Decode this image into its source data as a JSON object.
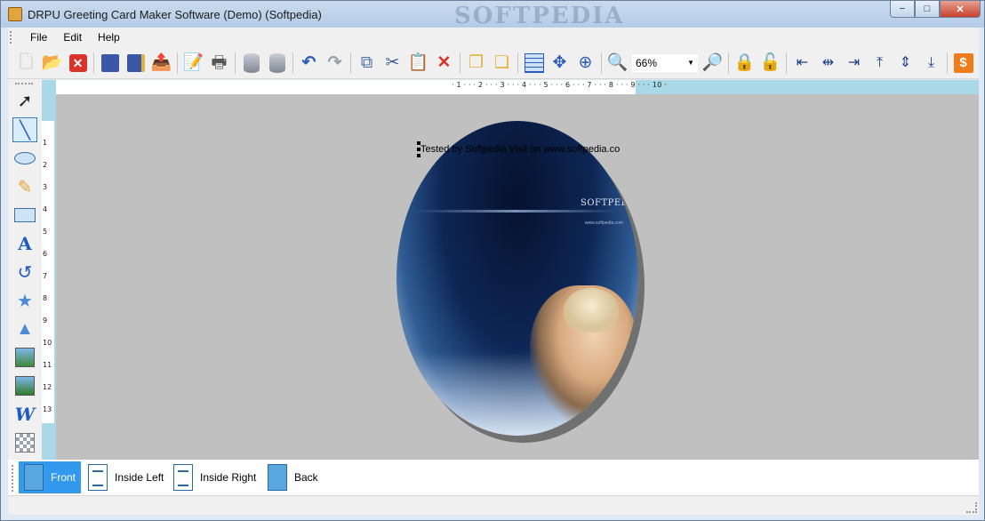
{
  "window": {
    "title": "DRPU Greeting Card Maker Software (Demo) (Softpedia)",
    "title_watermark": "SOFTPEDIA",
    "controls": {
      "minimize": "−",
      "maximize": "□",
      "close": "✕"
    }
  },
  "menu": {
    "items": [
      "File",
      "Edit",
      "Help"
    ]
  },
  "toolbar": {
    "zoom": {
      "value": "66%"
    },
    "icons": [
      "new-icon",
      "open-icon",
      "close-icon",
      "save-icon",
      "save-as-icon",
      "export-icon",
      "edit-icon",
      "print-icon",
      "database-add-icon",
      "database-icon",
      "undo-icon",
      "redo-icon",
      "copy-icon",
      "cut-icon",
      "paste-icon",
      "delete-icon",
      "bring-front-icon",
      "send-back-icon",
      "grid-icon",
      "fit-icon",
      "fit-page-icon",
      "zoom-in-icon",
      "zoom-out-icon",
      "lock-icon",
      "unlock-icon",
      "align-left-icon",
      "align-center-icon",
      "align-right-icon",
      "align-top-icon",
      "align-middle-icon",
      "align-bottom-icon",
      "buy-icon"
    ]
  },
  "palette": {
    "tools": [
      "select-tool-icon",
      "line-tool-icon",
      "ellipse-tool-icon",
      "pencil-tool-icon",
      "rectangle-tool-icon",
      "text-tool-icon",
      "curve-tool-icon",
      "star-tool-icon",
      "triangle-tool-icon",
      "image-tool-icon",
      "picture-library-icon",
      "wordart-tool-icon",
      "background-tool-icon"
    ],
    "active_tool": "line-tool-icon"
  },
  "rulers": {
    "horizontal": "· 1 · · · 2 · · · 3 · · · 4 · · · 5 · · · 6 · · · 7 · · · 8 · · · 9 · · · 10 ·",
    "vertical": [
      "1",
      "2",
      "3",
      "4",
      "5",
      "6",
      "7",
      "8",
      "9",
      "10",
      "11",
      "12",
      "13"
    ]
  },
  "card": {
    "text": "Tested by Softpedia Visit on www.softpedia.co",
    "brand": "SOFTPEDIA",
    "brand_sub": "www.softpedia.com"
  },
  "pages": {
    "tabs": [
      {
        "label": "Front",
        "active": true
      },
      {
        "label": "Inside Left",
        "active": false
      },
      {
        "label": "Inside Right",
        "active": false
      },
      {
        "label": "Back",
        "active": false
      }
    ]
  },
  "colors": {
    "accent": "#3399ee",
    "ruler": "#a9d8e6",
    "canvas": "#c0c0c0"
  }
}
